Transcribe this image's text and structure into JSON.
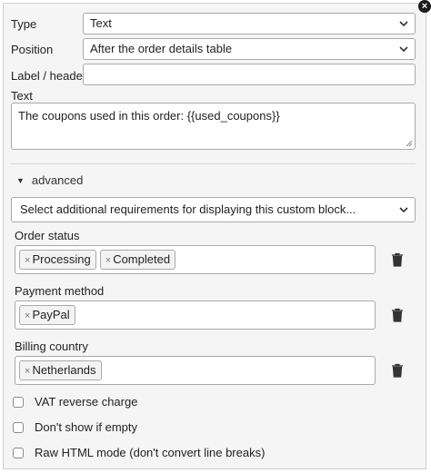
{
  "form": {
    "type_label": "Type",
    "type_value": "Text",
    "position_label": "Position",
    "position_value": "After the order details table",
    "label_header_label": "Label / header",
    "label_header_value": "",
    "text_label": "Text",
    "text_value": "The coupons used in this order: {{used_coupons}}"
  },
  "advanced": {
    "toggle_label": "advanced",
    "requirements_placeholder": "Select additional requirements for displaying this custom block..."
  },
  "requirements": [
    {
      "label": "Order status",
      "tags": [
        "Processing",
        "Completed"
      ]
    },
    {
      "label": "Payment method",
      "tags": [
        "PayPal"
      ]
    },
    {
      "label": "Billing country",
      "tags": [
        "Netherlands"
      ]
    }
  ],
  "tag_remove_glyph": "×",
  "checkboxes": [
    {
      "label": "VAT reverse charge",
      "checked": false
    },
    {
      "label": "Don't show if empty",
      "checked": false
    },
    {
      "label": "Raw HTML mode (don't convert line breaks)",
      "checked": false
    }
  ],
  "icons": {
    "close": "close-icon",
    "chevron": "chevron-down-icon",
    "trash": "trash-icon",
    "caret": "caret-down-icon"
  },
  "colors": {
    "panel_bg": "#f5f5f5",
    "border": "#a9a9a9",
    "text": "#222222",
    "trash": "#333333"
  }
}
